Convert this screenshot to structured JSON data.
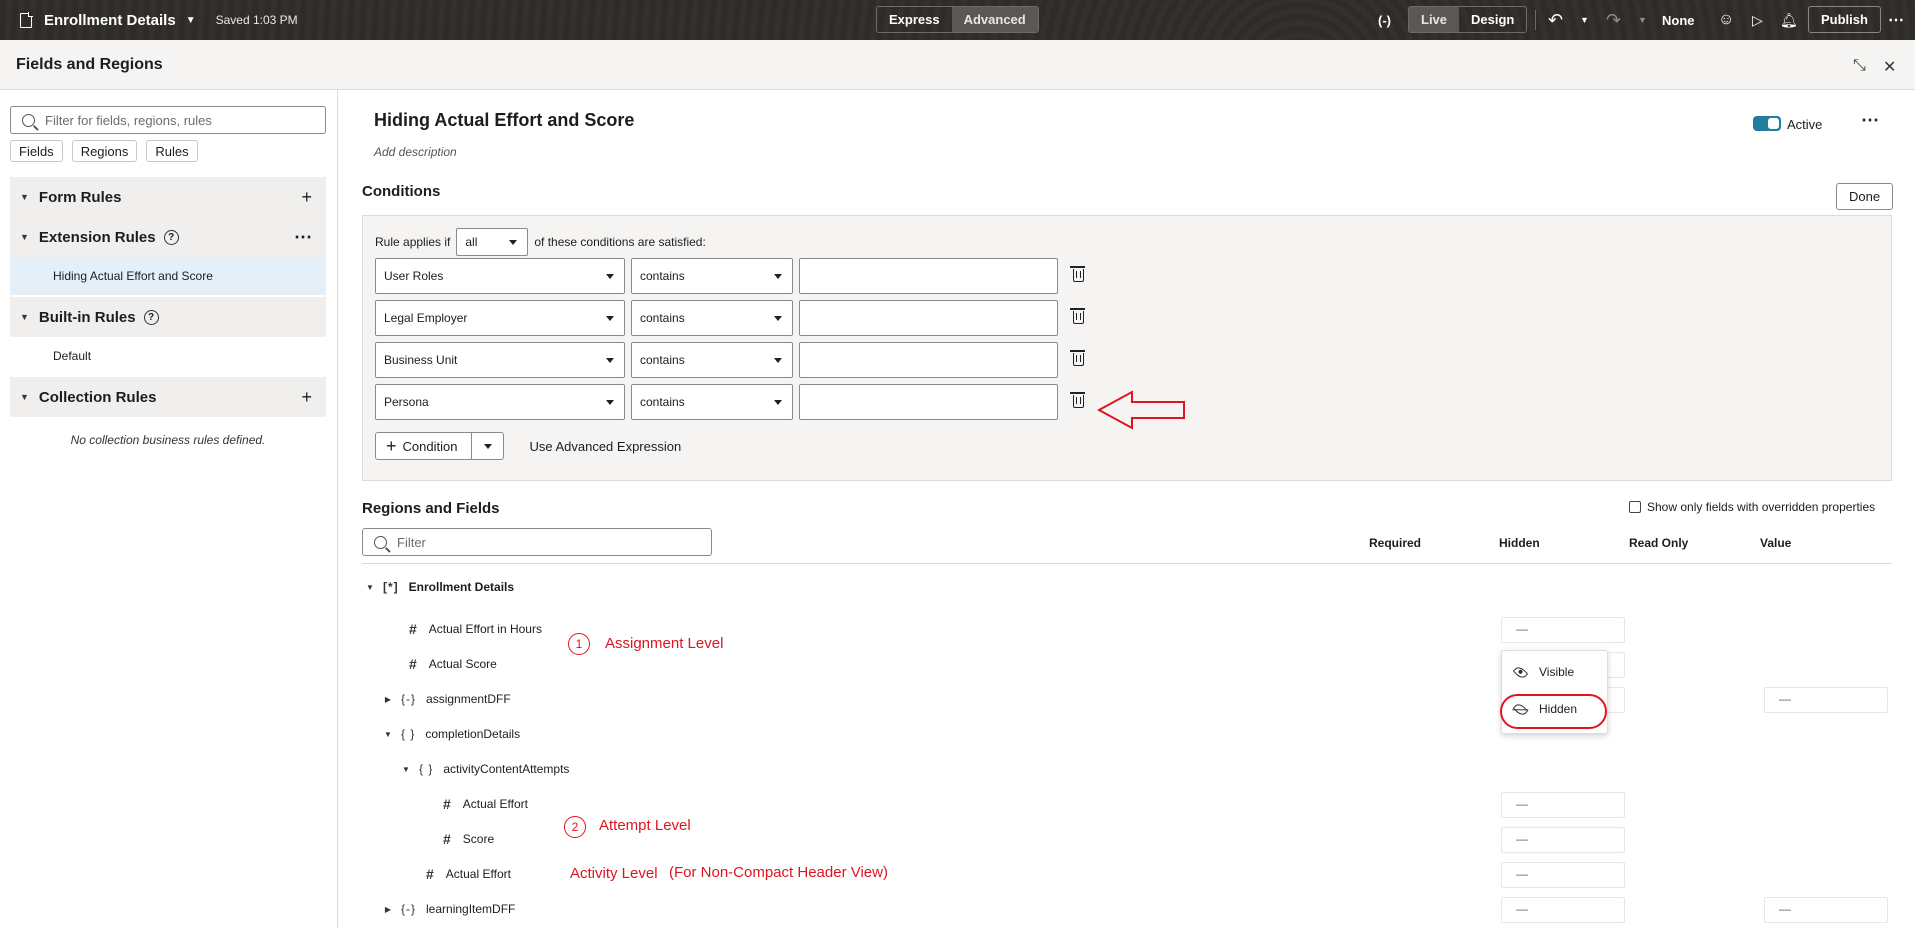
{
  "topbar": {
    "title": "Enrollment Details",
    "saved": "Saved 1:03 PM",
    "mode_tabs": [
      {
        "label": "Express",
        "active": false
      },
      {
        "label": "Advanced",
        "active": true
      }
    ],
    "view_tabs": [
      {
        "label": "Live",
        "active": true
      },
      {
        "label": "Design",
        "active": false
      }
    ],
    "bracket_icon": "(-)",
    "undo_icon": "↶",
    "redo_icon": "↷",
    "none_label": "None",
    "publish_label": "Publish",
    "more": "⋯"
  },
  "panel": {
    "title": "Fields and Regions",
    "collapse_icon": "⤡",
    "close_icon": "✕"
  },
  "left": {
    "search_placeholder": "Filter for fields, regions, rules",
    "chips": [
      "Fields",
      "Regions",
      "Rules"
    ],
    "sections": {
      "form_rules": "Form Rules",
      "extension_rules": "Extension Rules",
      "extension_item": "Hiding Actual Effort and Score",
      "builtin_rules": "Built-in Rules",
      "builtin_item": "Default",
      "collection_rules": "Collection Rules",
      "collection_empty": "No collection business rules defined."
    },
    "plus": "+",
    "more": "⋯",
    "help": "?"
  },
  "rule": {
    "title": "Hiding Actual Effort and Score",
    "add_description": "Add description",
    "active_label": "Active",
    "more": "⋯"
  },
  "conditions": {
    "title": "Conditions",
    "done_label": "Done",
    "applies_prefix": "Rule applies if",
    "applies_value": "all",
    "applies_suffix": "of these conditions are satisfied:",
    "rows": [
      {
        "field": "User Roles",
        "operator": "contains",
        "value": ""
      },
      {
        "field": "Legal Employer",
        "operator": "contains",
        "value": ""
      },
      {
        "field": "Business Unit",
        "operator": "contains",
        "value": ""
      },
      {
        "field": "Persona",
        "operator": "contains",
        "value": ""
      }
    ],
    "add_condition_label": "Condition",
    "advanced_expression_label": "Use Advanced Expression"
  },
  "regions": {
    "title": "Regions and Fields",
    "only_overridden_label": "Show only fields with overridden properties",
    "filter_placeholder": "Filter",
    "columns": [
      "Required",
      "Hidden",
      "Read Only",
      "Value"
    ],
    "tree": {
      "root": "Enrollment Details",
      "actual_effort_hours": "Actual Effort in Hours",
      "actual_score": "Actual Score",
      "assignment_dff": "assignmentDFF",
      "completion_details": "completionDetails",
      "activity_content_attempts": "activityContentAttempts",
      "actual_effort": "Actual Effort",
      "score": "Score",
      "actual_effort_activity": "Actual Effort",
      "learning_item_dff": "learningItemDFF"
    }
  },
  "visibility_menu": {
    "visible_label": "Visible",
    "hidden_label": "Hidden"
  },
  "annotations": {
    "n1": "1",
    "assignment_level": "Assignment Level",
    "n2": "2",
    "attempt_level": "Attempt Level",
    "activity_level": "Activity Level",
    "non_compact": "(For Non-Compact Header View)"
  },
  "colors": {
    "topbar": "#2b2925",
    "accent": "#227e9e",
    "annotation_red": "#e0141e",
    "selected_row": "#e4eff7"
  }
}
